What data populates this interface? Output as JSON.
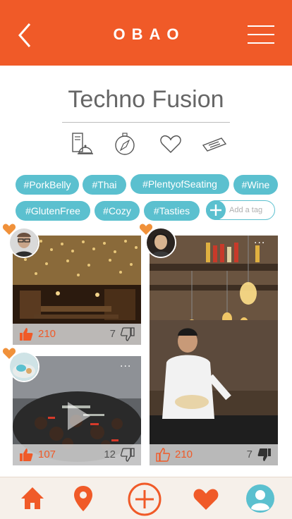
{
  "app": {
    "brand": "OBAO"
  },
  "page": {
    "title": "Techno Fusion"
  },
  "icons": {
    "back": "chevron-left-icon",
    "menu": "hamburger-menu-icon",
    "row": [
      "menu-card-icon",
      "compass-icon",
      "heart-outline-icon",
      "ticket-icon"
    ]
  },
  "tags": [
    "#PorkBelly",
    "#Thai",
    "#PlentyofSeating",
    "#Wine",
    "#GlutenFree",
    "#Cozy",
    "#Tasties"
  ],
  "add_tag": {
    "placeholder": "Add a tag"
  },
  "cards": [
    {
      "likes": "210",
      "dislikes": "7",
      "scene": "restaurant interior with gold ceiling lights"
    },
    {
      "likes": "107",
      "dislikes": "12",
      "scene": "sizzling dish video",
      "more": "..."
    },
    {
      "likes": "210",
      "dislikes": "7",
      "scene": "chef at bar counter with hanging bulbs",
      "more": "..."
    }
  ],
  "bottom_nav": [
    "home-icon",
    "location-pin-icon",
    "add-circle-icon",
    "heart-icon",
    "profile-icon"
  ],
  "colors": {
    "brand": "#f05a28",
    "tag": "#5bc0cf",
    "nav_bg": "#f6f0ea",
    "profile": "#5bc0cf"
  }
}
